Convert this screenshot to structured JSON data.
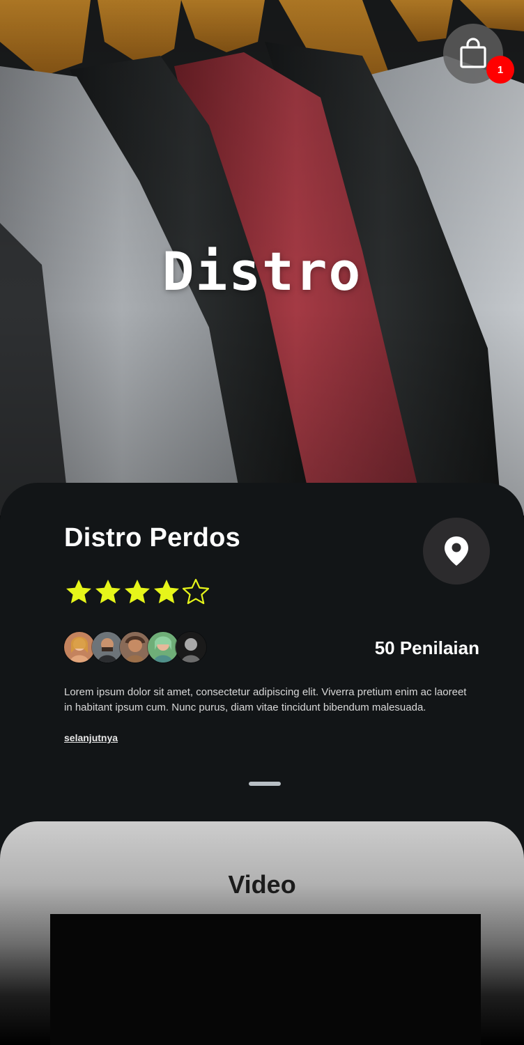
{
  "hero": {
    "brand": "Distro",
    "cart": {
      "icon": "shopping-bag-icon",
      "badge_count": "1",
      "badge_color": "#ff0000"
    }
  },
  "store": {
    "name": "Distro Perdos",
    "location_icon": "location-pin-icon",
    "rating": 4,
    "rating_max": 5,
    "star_color": "#e6f51a",
    "reviewer_avatars": [
      "avatar-1",
      "avatar-2",
      "avatar-3",
      "avatar-4",
      "avatar-5"
    ],
    "review_count_label": "50 Penilaian",
    "description": "Lorem ipsum dolor sit amet, consectetur adipiscing elit. Viverra pretium enim ac laoreet in habitant ipsum cum. Nunc purus, diam vitae tincidunt bibendum malesuada.",
    "read_more_label": "selanjutnya"
  },
  "video": {
    "title": "Video"
  },
  "colors": {
    "card_background": "#121517",
    "accent_star": "#e6f51a",
    "badge": "#ff0000"
  }
}
